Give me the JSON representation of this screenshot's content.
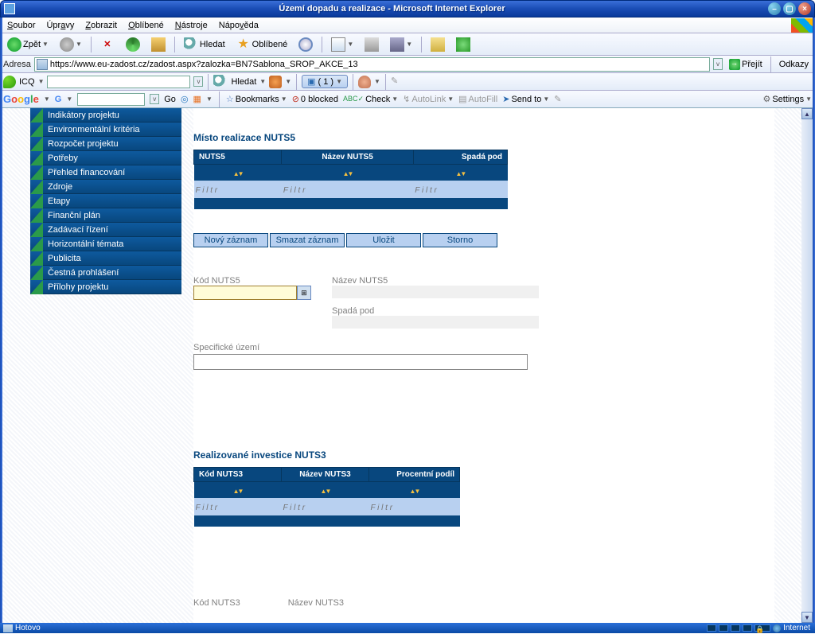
{
  "window": {
    "title": "Území dopadu a realizace - Microsoft Internet Explorer"
  },
  "menu": {
    "items": [
      "Soubor",
      "Úpravy",
      "Zobrazit",
      "Oblíbené",
      "Nástroje",
      "Nápověda"
    ]
  },
  "toolbar": {
    "back": "Zpět",
    "search": "Hledat",
    "favorites": "Oblíbené"
  },
  "address": {
    "label": "Adresa",
    "url": "https://www.eu-zadost.cz/zadost.aspx?zalozka=BN7Sablona_SROP_AKCE_13",
    "go": "Přejít",
    "links": "Odkazy"
  },
  "icq": {
    "label": "ICQ",
    "search": "Hledat",
    "tabcount": "( 1 )"
  },
  "google": {
    "logo": "Google",
    "go": "Go",
    "bookmarks": "Bookmarks",
    "blocked": "0 blocked",
    "check": "Check",
    "autolink": "AutoLink",
    "autofill": "AutoFill",
    "sendto": "Send to",
    "settings": "Settings"
  },
  "sidebar": {
    "items": [
      "Indikátory projektu",
      "Environmentální kritéria",
      "Rozpočet projektu",
      "Potřeby",
      "Přehled financování",
      "Zdroje",
      "Etapy",
      "Finanční plán",
      "Zadávací řízení",
      "Horizontální témata",
      "Publicita",
      "Čestná prohlášení",
      "Přílohy projektu"
    ]
  },
  "nuts5": {
    "title": "Místo realizace NUTS5",
    "cols": [
      "NUTS5",
      "Název NUTS5",
      "Spadá pod"
    ],
    "filter": "F i l t r",
    "buttons": [
      "Nový záznam",
      "Smazat záznam",
      "Uložit",
      "Storno"
    ],
    "fields": {
      "kod": "Kód NUTS5",
      "nazev": "Název NUTS5",
      "spada": "Spadá pod",
      "spec": "Specifické území"
    }
  },
  "nuts3": {
    "title": "Realizované investice NUTS3",
    "cols": [
      "Kód NUTS3",
      "Název NUTS3",
      "Procentní podíl"
    ],
    "filter": "F i l t r",
    "fields": {
      "kod": "Kód NUTS3",
      "nazev": "Název NUTS3"
    }
  },
  "status": {
    "text": "Hotovo",
    "zone": "Internet"
  }
}
